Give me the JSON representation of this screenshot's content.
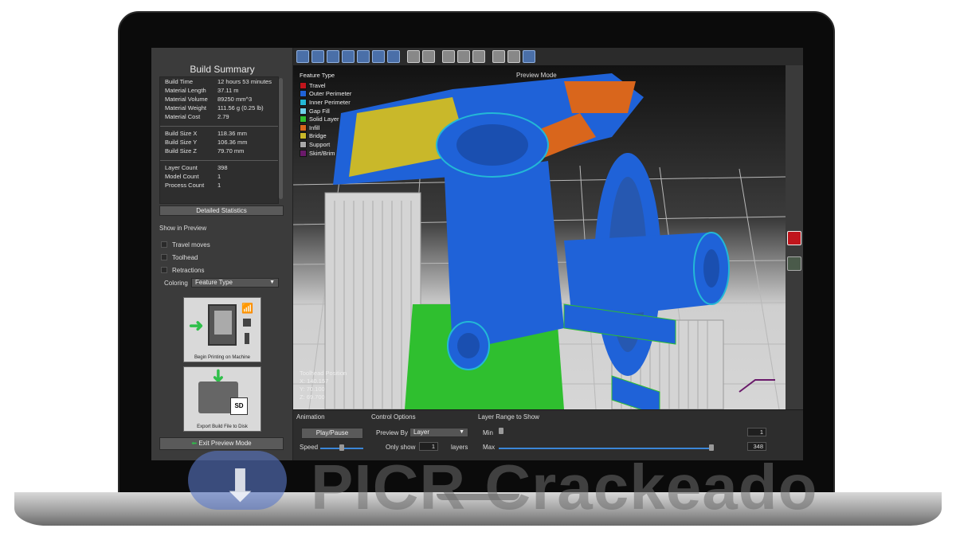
{
  "build_summary": {
    "title": "Build Summary",
    "rows1": [
      {
        "k": "Build Time",
        "v": "12 hours 53 minutes"
      },
      {
        "k": "Material Length",
        "v": "37.11 m"
      },
      {
        "k": "Material Volume",
        "v": "89250 mm^3"
      },
      {
        "k": "Material Weight",
        "v": "111.56 g (0.25 lb)"
      },
      {
        "k": "Material Cost",
        "v": "2.79"
      }
    ],
    "rows2": [
      {
        "k": "Build Size X",
        "v": "118.36 mm"
      },
      {
        "k": "Build Size Y",
        "v": "106.36 mm"
      },
      {
        "k": "Build Size Z",
        "v": "79.70 mm"
      }
    ],
    "rows3": [
      {
        "k": "Layer Count",
        "v": "398"
      },
      {
        "k": "Model Count",
        "v": "1"
      },
      {
        "k": "Process Count",
        "v": "1"
      }
    ],
    "detailed_stats_label": "Detailed Statistics"
  },
  "show_in_preview": {
    "title": "Show in Preview",
    "options": [
      "Travel moves",
      "Toolhead",
      "Retractions"
    ],
    "coloring_label": "Coloring",
    "coloring_value": "Feature Type"
  },
  "actions": {
    "begin_printing": "Begin Printing on Machine",
    "export": "Export Build File to Disk",
    "sd_label": "SD",
    "exit_preview": "Exit Preview Mode"
  },
  "viewport": {
    "preview_mode": "Preview Mode",
    "legend_title": "Feature Type",
    "legend": [
      {
        "name": "Travel",
        "color": "#c0151c"
      },
      {
        "name": "Outer Perimeter",
        "color": "#1f62d8"
      },
      {
        "name": "Inner Perimeter",
        "color": "#23b8d6"
      },
      {
        "name": "Gap Fill",
        "color": "#6fd0e8"
      },
      {
        "name": "Solid Layer",
        "color": "#2fbf2f"
      },
      {
        "name": "Infill",
        "color": "#d9661c"
      },
      {
        "name": "Bridge",
        "color": "#c9b82a"
      },
      {
        "name": "Support",
        "color": "#a8a8a8"
      },
      {
        "name": "Skirt/Brim",
        "color": "#6a1a6a"
      }
    ],
    "toolhead_position_title": "Toolhead Position",
    "toolhead_x": "X: 140.157",
    "toolhead_y": "Y: 70.100",
    "toolhead_z": "Z: 69.700"
  },
  "bottom": {
    "animation_title": "Animation",
    "play_pause": "Play/Pause",
    "speed_label": "Speed",
    "control_title": "Control Options",
    "preview_by_label": "Preview By",
    "preview_by_value": "Layer",
    "only_show_label": "Only show",
    "only_show_value": "1",
    "layers_label": "layers",
    "range_title": "Layer Range to Show",
    "min_label": "Min",
    "min_value": "1",
    "max_label": "Max",
    "max_value": "348"
  },
  "watermark": {
    "text": "PICR Crackeado"
  }
}
